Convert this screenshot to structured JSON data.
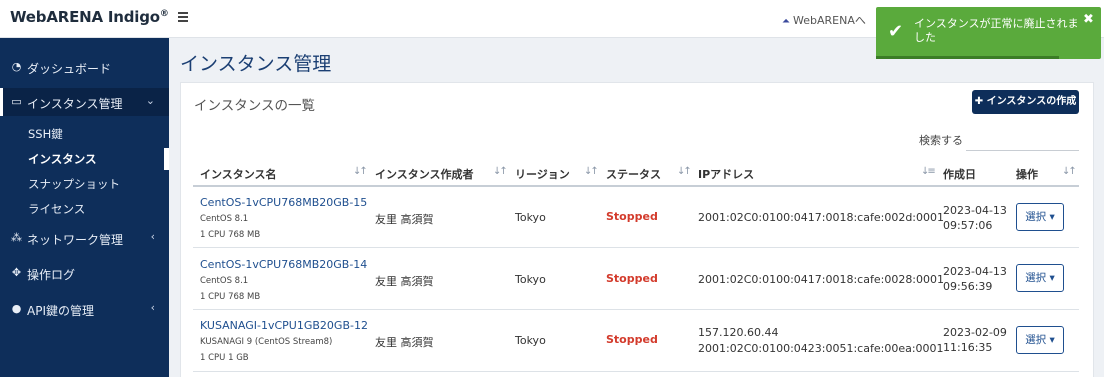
{
  "brand": {
    "name": "WebARENA Indigo",
    "mark": "®"
  },
  "topbar": {
    "link_label": "WebARENAへ"
  },
  "toast": {
    "message": "インスタンスが正常に廃止されました"
  },
  "sidebar": {
    "items": [
      {
        "label": "ダッシュボード",
        "icon": "dashboard-icon"
      },
      {
        "label": "インスタンス管理",
        "icon": "monitor-icon",
        "expanded": true
      },
      {
        "label": "ネットワーク管理",
        "icon": "network-icon"
      },
      {
        "label": "操作ログ",
        "icon": "move-icon"
      },
      {
        "label": "API鍵の管理",
        "icon": "user-icon"
      }
    ],
    "subitems": [
      "SSH鍵",
      "インスタンス",
      "スナップショット",
      "ライセンス"
    ]
  },
  "page": {
    "title": "インスタンス管理"
  },
  "card": {
    "title": "インスタンスの一覧",
    "create_button": "インスタンスの作成",
    "search_label": "検索する"
  },
  "table": {
    "headers": [
      "インスタンス名",
      "インスタンス作成者",
      "リージョン",
      "ステータス",
      "IPアドレス",
      "作成日",
      "操作"
    ],
    "rows": [
      {
        "name": "CentOS-1vCPU768MB20GB-15",
        "os": "CentOS 8.1",
        "spec": "1 CPU 768 MB",
        "creator": "友里 高須賀",
        "region": "Tokyo",
        "status": "Stopped",
        "ip1": "2001:02C0:0100:0417:0018:cafe:002d:0001",
        "ip2": "",
        "date": "2023-04-13",
        "time": "09:57:06",
        "action": "選択"
      },
      {
        "name": "CentOS-1vCPU768MB20GB-14",
        "os": "CentOS 8.1",
        "spec": "1 CPU 768 MB",
        "creator": "友里 高須賀",
        "region": "Tokyo",
        "status": "Stopped",
        "ip1": "2001:02C0:0100:0417:0018:cafe:0028:0001",
        "ip2": "",
        "date": "2023-04-13",
        "time": "09:56:39",
        "action": "選択"
      },
      {
        "name": "KUSANAGI-1vCPU1GB20GB-12",
        "os": "KUSANAGI 9 (CentOS Stream8)",
        "spec": "1 CPU 1 GB",
        "creator": "友里 高須賀",
        "region": "Tokyo",
        "status": "Stopped",
        "ip1": "157.120.60.44",
        "ip2": "2001:02C0:0100:0423:0051:cafe:00ea:0001",
        "date": "2023-02-09",
        "time": "11:16:35",
        "action": "選択"
      }
    ]
  },
  "colors": {
    "sidebar": "#0e2e5a",
    "accent": "#1f4f8f",
    "stopped": "#d33b2c",
    "toast": "#5aaa3c"
  }
}
